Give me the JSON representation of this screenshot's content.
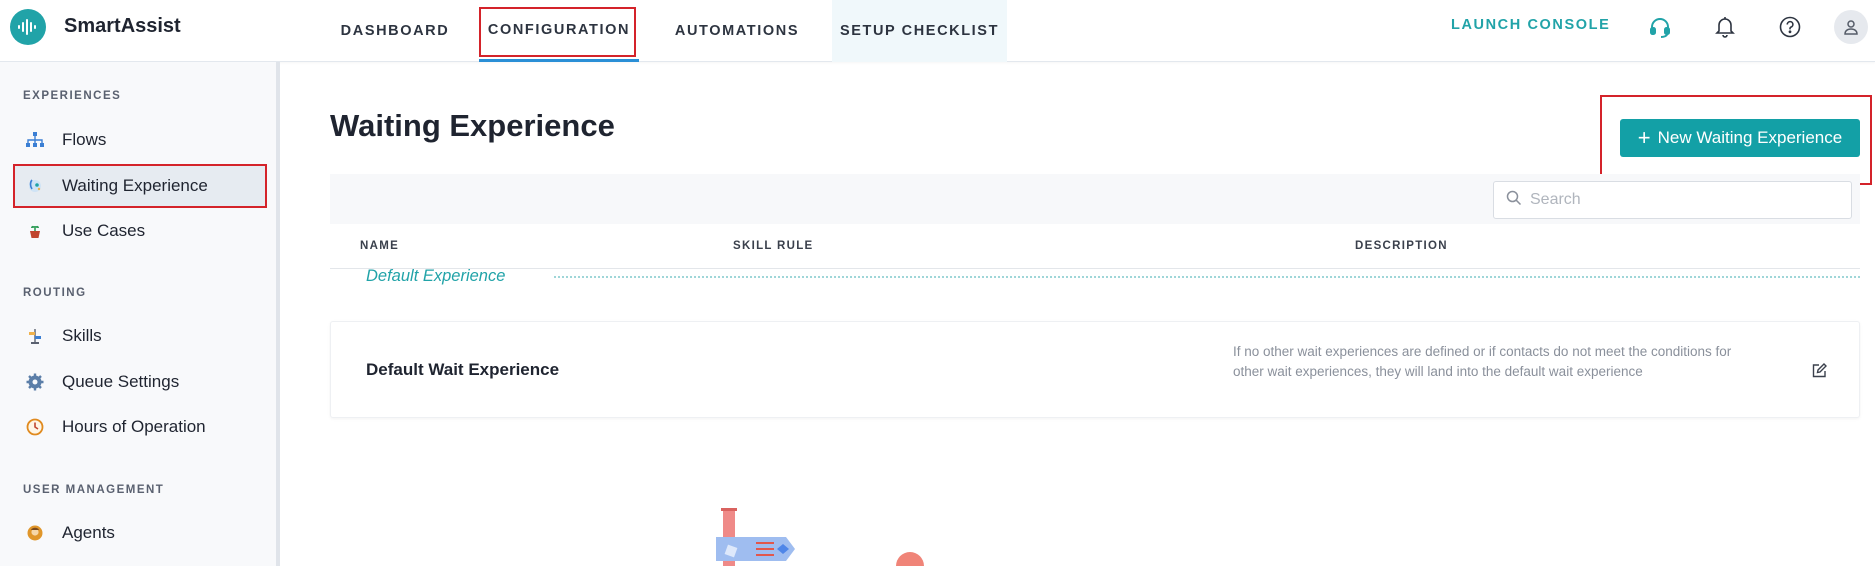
{
  "app": {
    "name": "SmartAssist"
  },
  "nav": {
    "tabs": [
      {
        "label": "DASHBOARD"
      },
      {
        "label": "CONFIGURATION"
      },
      {
        "label": "AUTOMATIONS"
      },
      {
        "label": "SETUP CHECKLIST"
      }
    ],
    "active_tab": "CONFIGURATION",
    "launch_console": "LAUNCH CONSOLE",
    "icons": [
      "headset-icon",
      "bell-icon",
      "help-icon",
      "user-avatar-icon"
    ]
  },
  "sidebar": {
    "sections": [
      {
        "title": "EXPERIENCES",
        "items": [
          {
            "label": "Flows",
            "icon": "flows-icon"
          },
          {
            "label": "Waiting Experience",
            "icon": "waiting-experience-icon",
            "active": true
          },
          {
            "label": "Use Cases",
            "icon": "use-cases-icon"
          }
        ]
      },
      {
        "title": "ROUTING",
        "items": [
          {
            "label": "Skills",
            "icon": "skills-icon"
          },
          {
            "label": "Queue Settings",
            "icon": "queue-settings-icon"
          },
          {
            "label": "Hours of Operation",
            "icon": "clock-icon"
          }
        ]
      },
      {
        "title": "USER MANAGEMENT",
        "items": [
          {
            "label": "Agents",
            "icon": "agents-icon"
          }
        ]
      }
    ]
  },
  "main": {
    "title": "Waiting Experience",
    "new_button": "New Waiting Experience",
    "search": {
      "placeholder": "Search",
      "value": ""
    },
    "table": {
      "columns": [
        "NAME",
        "SKILL RULE",
        "DESCRIPTION"
      ],
      "groups": [
        {
          "label": "Default Experience",
          "rows": [
            {
              "name": "Default Wait Experience",
              "skill_rule": "",
              "description": "If no other wait experiences are defined or if contacts do not meet the conditions for other wait experiences, they will land into the default wait experience"
            }
          ]
        }
      ]
    }
  },
  "colors": {
    "accent": "#13a0a6",
    "highlight_box": "#d4232a",
    "active_tab_underline": "#2a8fd6"
  }
}
